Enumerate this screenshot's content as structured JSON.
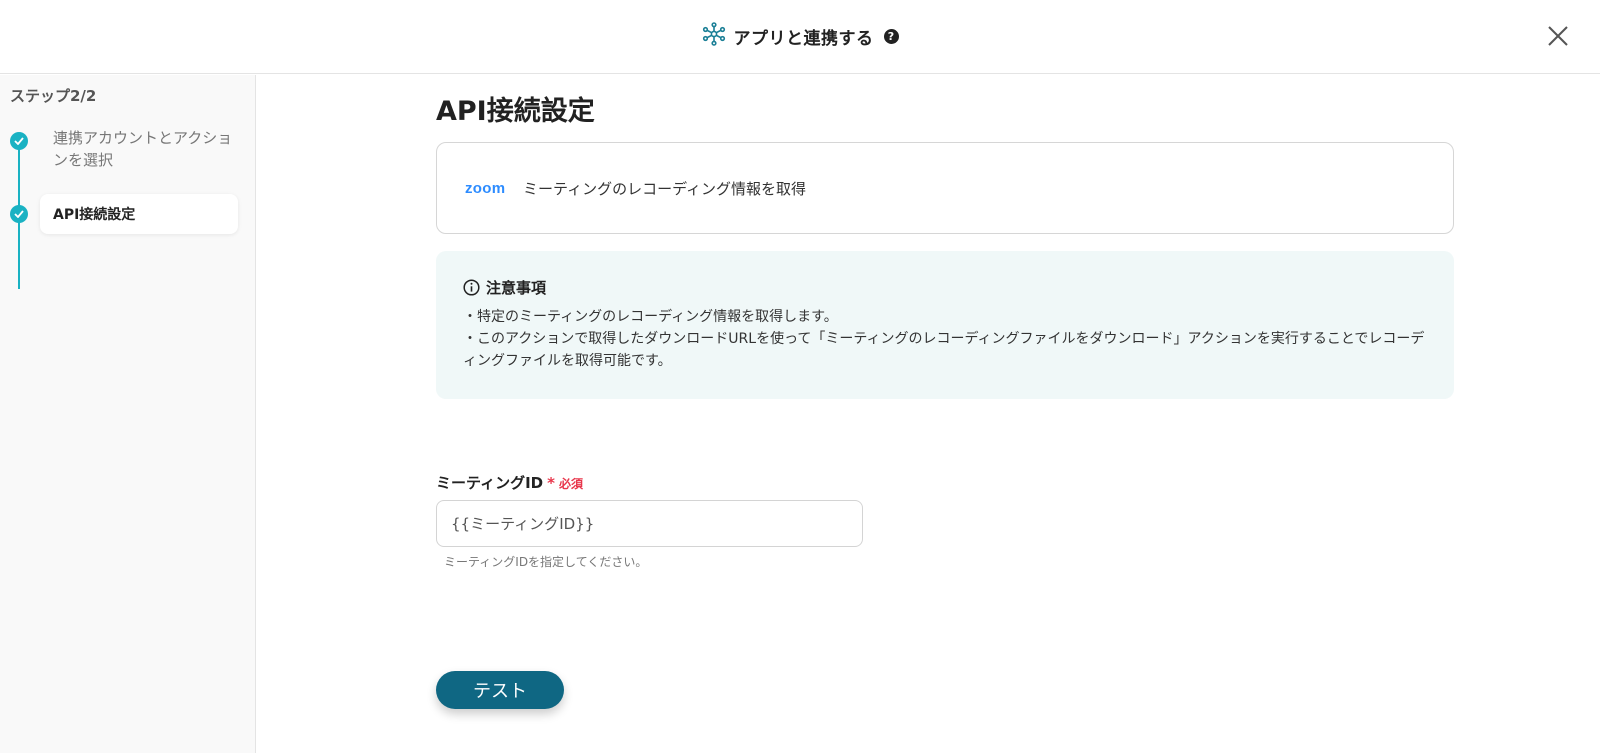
{
  "header": {
    "title": "アプリと連携する",
    "help_glyph": "?",
    "icon": "network-hub-icon"
  },
  "sidebar": {
    "step_count": "ステップ2/2",
    "steps": [
      {
        "label": "連携アカウントとアクションを選択",
        "status": "completed"
      },
      {
        "label": "API接続設定",
        "status": "active"
      }
    ]
  },
  "main": {
    "title": "API接続設定",
    "action": {
      "app_logo": "zoom",
      "title": "ミーティングのレコーディング情報を取得"
    },
    "notice": {
      "title": "注意事項",
      "lines": [
        "・特定のミーティングのレコーディング情報を取得します。",
        "・このアクションで取得したダウンロードURLを使って「ミーティングのレコーディングファイルをダウンロード」アクションを実行することでレコーディングファイルを取得可能です。"
      ]
    },
    "meeting_id_field": {
      "label": "ミーティングID",
      "required_mark": "*",
      "required_text": "必須",
      "value": "{{ミーティングID}}",
      "help": "ミーティングIDを指定してください。"
    },
    "test_button": "テスト"
  },
  "colors": {
    "accent": "#1ab2c3",
    "button": "#0f6783",
    "required": "#e8364b",
    "notice_bg": "#f0f8f8",
    "zoom_blue": "#2d8cff"
  }
}
